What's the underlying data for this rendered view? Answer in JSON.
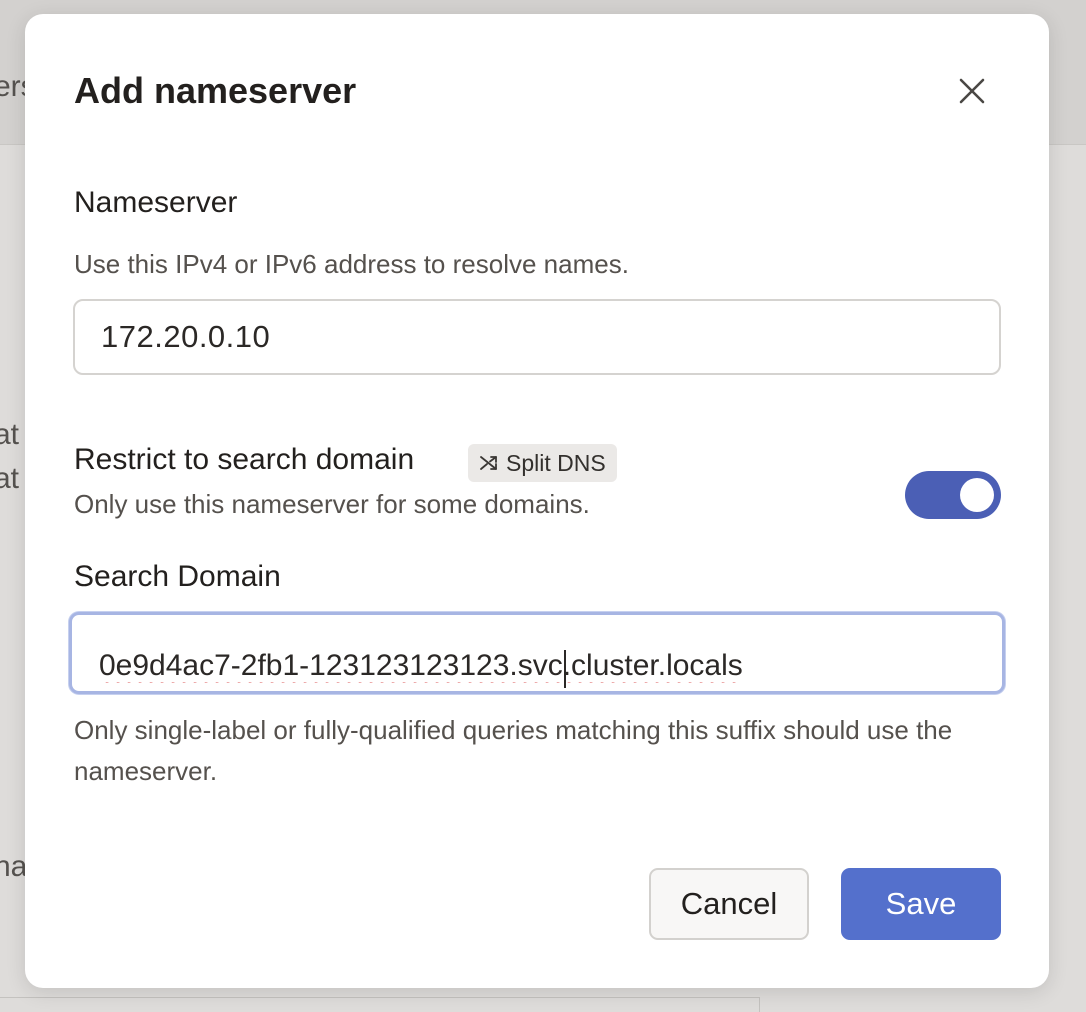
{
  "background": {
    "fragments": [
      "ers",
      "at",
      "at",
      "na"
    ]
  },
  "dialog": {
    "title": "Add nameserver",
    "close_icon": "close-icon"
  },
  "nameserver": {
    "label": "Nameserver",
    "description": "Use this IPv4 or IPv6 address to resolve names.",
    "value": "172.20.0.10"
  },
  "restrict": {
    "label": "Restrict to search domain",
    "badge_label": "Split DNS",
    "badge_icon": "shuffle-icon",
    "description": "Only use this nameserver for some domains.",
    "toggle_on": true
  },
  "search_domain": {
    "label": "Search Domain",
    "value": "0e9d4ac7-2fb1-123123123123.svc.cluster.locals",
    "helper": "Only single-label or fully-qualified queries matching this suffix should use the nameserver."
  },
  "actions": {
    "cancel_label": "Cancel",
    "save_label": "Save"
  },
  "colors": {
    "accent": "#5470cc",
    "toggle": "#4b5fb5",
    "focus_ring": "#a7b5e3"
  }
}
